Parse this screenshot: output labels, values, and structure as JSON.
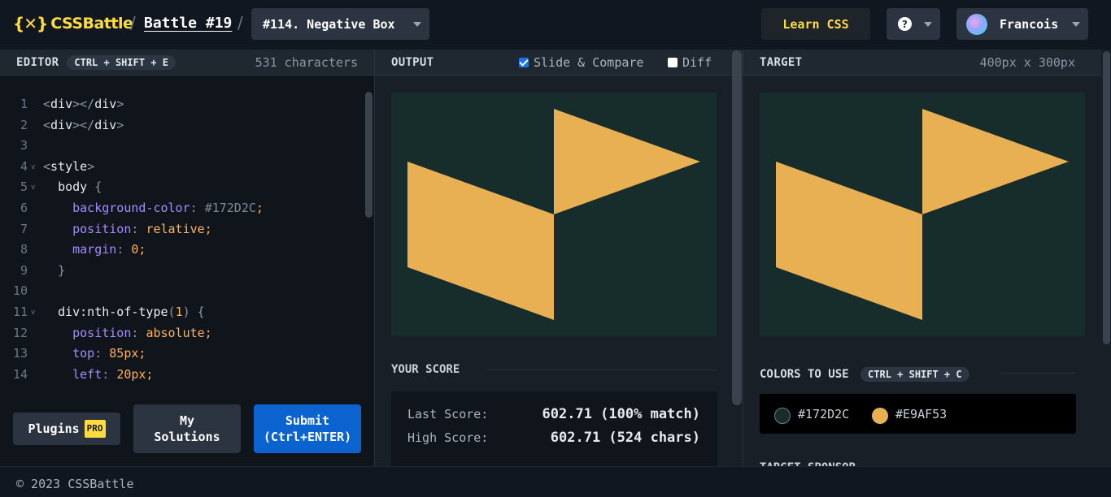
{
  "header": {
    "logo_mark": "{✕}",
    "logo_text": "CSSBattle",
    "breadcrumb_sep": "/",
    "battle": "Battle #19",
    "target_name": "#114. Negative Box",
    "learn_label": "Learn CSS",
    "help_icon": "?",
    "user_name": "Francois"
  },
  "editor": {
    "title": "EDITOR",
    "shortcut": "CTRL + SHIFT + E",
    "char_count": "531 characters",
    "lines": [
      {
        "n": "1",
        "fold": "",
        "html": "<span class='t-punc'>&lt;</span><span class='t-tag'>div</span><span class='t-punc'>&gt;&lt;/</span><span class='t-tag'>div</span><span class='t-punc'>&gt;</span>"
      },
      {
        "n": "2",
        "fold": "",
        "html": "<span class='t-punc'>&lt;</span><span class='t-tag'>div</span><span class='t-punc'>&gt;&lt;/</span><span class='t-tag'>div</span><span class='t-punc'>&gt;</span>"
      },
      {
        "n": "3",
        "fold": "",
        "html": ""
      },
      {
        "n": "4",
        "fold": "v",
        "html": "<span class='t-punc'>&lt;</span><span class='t-tag'>style</span><span class='t-punc'>&gt;</span>"
      },
      {
        "n": "5",
        "fold": "v",
        "html": "  <span class='t-sel'>body</span> <span class='t-punc'>{</span>"
      },
      {
        "n": "6",
        "fold": "",
        "html": "    <span class='t-prop'>background-color</span><span class='t-punc'>:</span> <span class='t-hex'>#172D2C</span><span class='t-val'>;</span>"
      },
      {
        "n": "7",
        "fold": "",
        "html": "    <span class='t-prop'>position</span><span class='t-punc'>:</span> <span class='t-val'>relative;</span>"
      },
      {
        "n": "8",
        "fold": "",
        "html": "    <span class='t-prop'>margin</span><span class='t-punc'>:</span> <span class='t-val'>0;</span>"
      },
      {
        "n": "9",
        "fold": "",
        "html": "  <span class='t-punc'>}</span>"
      },
      {
        "n": "10",
        "fold": "",
        "html": ""
      },
      {
        "n": "11",
        "fold": "v",
        "html": "  <span class='t-sel'>div:nth-of-type</span><span class='t-punc'>(</span><span class='t-val'>1</span><span class='t-punc'>)</span> <span class='t-punc'>{</span>"
      },
      {
        "n": "12",
        "fold": "",
        "html": "    <span class='t-prop'>position</span><span class='t-punc'>:</span> <span class='t-val'>absolute;</span>"
      },
      {
        "n": "13",
        "fold": "",
        "html": "    <span class='t-prop'>top</span><span class='t-punc'>:</span> <span class='t-val'>85px;</span>"
      },
      {
        "n": "14",
        "fold": "",
        "html": "    <span class='t-prop'>left</span><span class='t-punc'>:</span> <span class='t-val'>20px;</span>"
      }
    ],
    "plugins_label": "Plugins",
    "pro_badge": "PRO",
    "solutions_label": "My Solutions",
    "submit_label": "Submit (Ctrl+ENTER)"
  },
  "output": {
    "title": "OUTPUT",
    "slide_compare": "Slide & Compare",
    "slide_compare_checked": true,
    "diff": "Diff",
    "diff_checked": false,
    "score_title": "YOUR SCORE",
    "last_score_label": "Last Score:",
    "last_score_value": "602.71 (100% match)",
    "high_score_label": "High Score:",
    "high_score_value": "602.71 (524 chars)"
  },
  "target": {
    "title": "TARGET",
    "size": "400px x 300px",
    "colors_title": "COLORS TO USE",
    "colors_shortcut": "CTRL + SHIFT + C",
    "colors": [
      {
        "hex": "#172D2C"
      },
      {
        "hex": "#E9AF53"
      }
    ],
    "sponsor_title": "TARGET SPONSOR"
  },
  "theme": {
    "background": "#172D2C",
    "shape": "#E9AF53",
    "accent": "#FFDD40",
    "submit": "#0B63D0"
  },
  "footer": {
    "copyright": "© 2023 CSSBattle"
  }
}
